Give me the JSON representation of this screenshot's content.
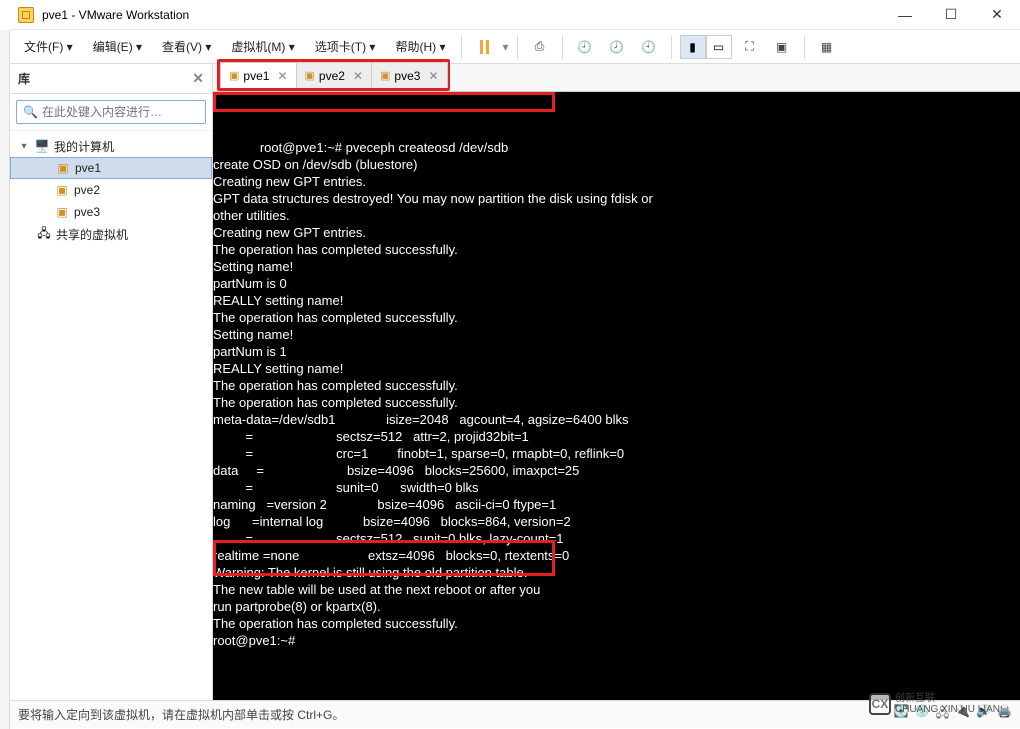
{
  "title": "pve1 - VMware Workstation",
  "menu": {
    "file": "文件(F)",
    "edit": "编辑(E)",
    "view": "查看(V)",
    "vm": "虚拟机(M)",
    "tabs": "选项卡(T)",
    "help": "帮助(H)"
  },
  "sidebar": {
    "header": "库",
    "search_placeholder": "在此处键入内容进行…",
    "tree": {
      "root_label": "我的计算机",
      "items": [
        {
          "label": "pve1",
          "selected": true
        },
        {
          "label": "pve2",
          "selected": false
        },
        {
          "label": "pve3",
          "selected": false
        }
      ],
      "shared_label": "共享的虚拟机"
    }
  },
  "tabs": [
    {
      "label": "pve1",
      "active": true
    },
    {
      "label": "pve2",
      "active": false
    },
    {
      "label": "pve3",
      "active": false
    }
  ],
  "terminal": {
    "prompt_line": "root@pve1:~# pveceph createosd /dev/sdb",
    "body": "create OSD on /dev/sdb (bluestore)\nCreating new GPT entries.\nGPT data structures destroyed! You may now partition the disk using fdisk or\nother utilities.\nCreating new GPT entries.\nThe operation has completed successfully.\nSetting name!\npartNum is 0\nREALLY setting name!\nThe operation has completed successfully.\nSetting name!\npartNum is 1\nREALLY setting name!\nThe operation has completed successfully.\nThe operation has completed successfully.\nmeta-data=/dev/sdb1              isize=2048   agcount=4, agsize=6400 blks\n         =                       sectsz=512   attr=2, projid32bit=1\n         =                       crc=1        finobt=1, sparse=0, rmapbt=0, reflink=0\ndata     =                       bsize=4096   blocks=25600, imaxpct=25\n         =                       sunit=0      swidth=0 blks\nnaming   =version 2              bsize=4096   ascii-ci=0 ftype=1\nlog      =internal log           bsize=4096   blocks=864, version=2\n         =                       sectsz=512   sunit=0 blks, lazy-count=1\nrealtime =none                   extsz=4096   blocks=0, rtextents=0\nWarning: The kernel is still using the old partition table.\nThe new table will be used at the next reboot or after you\nrun partprobe(8) or kpartx(8).\nThe operation has completed successfully.\nroot@pve1:~# "
  },
  "status": "要将输入定向到该虚拟机，请在虚拟机内部单击或按 Ctrl+G。",
  "watermark": {
    "brand": "创新互联",
    "sub": "CHUANG XIN HU LIAN"
  }
}
